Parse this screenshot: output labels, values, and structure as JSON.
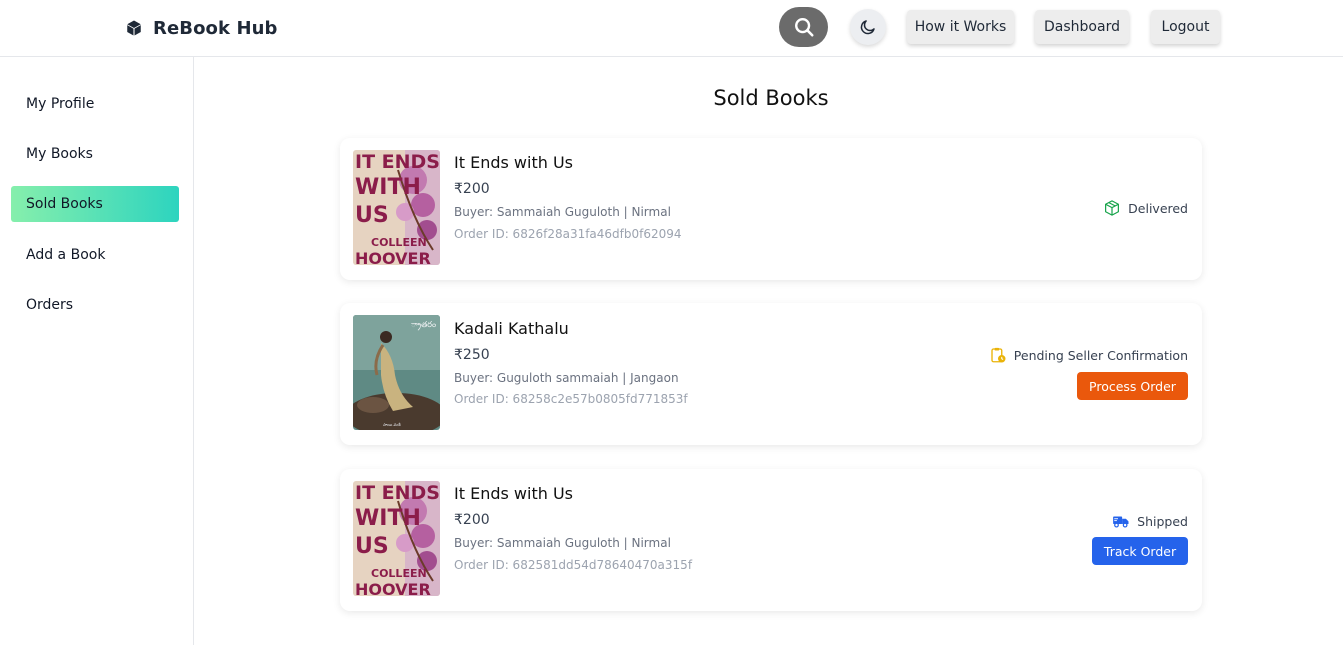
{
  "header": {
    "brand": "ReBook Hub",
    "nav": {
      "how_it_works": "How it Works",
      "dashboard": "Dashboard",
      "logout": "Logout"
    }
  },
  "sidebar": {
    "items": [
      {
        "label": "My Profile"
      },
      {
        "label": "My Books"
      },
      {
        "label": "Sold Books",
        "active": true
      },
      {
        "label": "Add a Book"
      },
      {
        "label": "Orders"
      }
    ]
  },
  "main": {
    "title": "Sold Books",
    "orders": [
      {
        "title": "It Ends with Us",
        "price": "₹200",
        "buyer": "Buyer: Sammaiah Guguloth | Nirmal",
        "order_id": "Order ID: 6826f28a31fa46dfb0f62094",
        "status": "Delivered",
        "status_icon": "box-icon",
        "action": null
      },
      {
        "title": "Kadali Kathalu",
        "price": "₹250",
        "buyer": "Buyer: Guguloth sammaiah | Jangaon",
        "order_id": "Order ID: 68258c2e57b0805fd771853f",
        "status": "Pending Seller Confirmation",
        "status_icon": "clipboard-clock-icon",
        "action": "Process Order",
        "action_color": "#ea580c"
      },
      {
        "title": "It Ends with Us",
        "price": "₹200",
        "buyer": "Buyer: Sammaiah Guguloth | Nirmal",
        "order_id": "Order ID: 682581dd54d78640470a315f",
        "status": "Shipped",
        "status_icon": "truck-icon",
        "action": "Track Order",
        "action_color": "#2563eb"
      }
    ]
  },
  "covers": {
    "ends_with_us": {
      "top_text": "IT ENDS",
      "mid_text": "WITH",
      "us_text": "US",
      "author_first": "COLLEEN",
      "author_last": "HOOVER"
    }
  },
  "colors": {
    "accent_gradient_start": "#86efac",
    "accent_gradient_end": "#2dd4bf",
    "delivered": "#16a34a",
    "pending": "#eab308",
    "shipped": "#2563eb"
  }
}
